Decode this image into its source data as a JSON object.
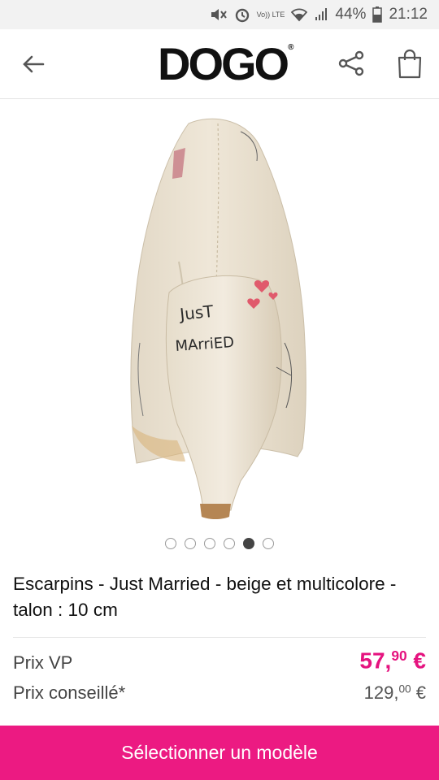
{
  "status_bar": {
    "battery": "44%",
    "time": "21:12",
    "volte_label": "Vo)) LTE"
  },
  "header": {
    "brand": "DOGO",
    "brand_mark": "®",
    "icons": [
      "back-arrow-icon",
      "share-icon",
      "shopping-bag-icon"
    ]
  },
  "gallery": {
    "heel_text_line1": "JusT",
    "heel_text_line2": "MArriED",
    "current_index": 5,
    "dot_count": 6
  },
  "product": {
    "title": "Escarpins  -  Just Married  -  beige et multicolore  -  talon : 10 cm"
  },
  "pricing": {
    "vp_label": "Prix VP",
    "vp_main": "57,",
    "vp_cents": "90",
    "vp_currency": " €",
    "conseille_label": "Prix conseillé*",
    "cons_main": "129,",
    "cons_cents": "00",
    "cons_currency": " €"
  },
  "cta": {
    "label": "Sélectionner un modèle"
  },
  "colors": {
    "accent": "#ec1a82",
    "price": "#e5137f"
  }
}
